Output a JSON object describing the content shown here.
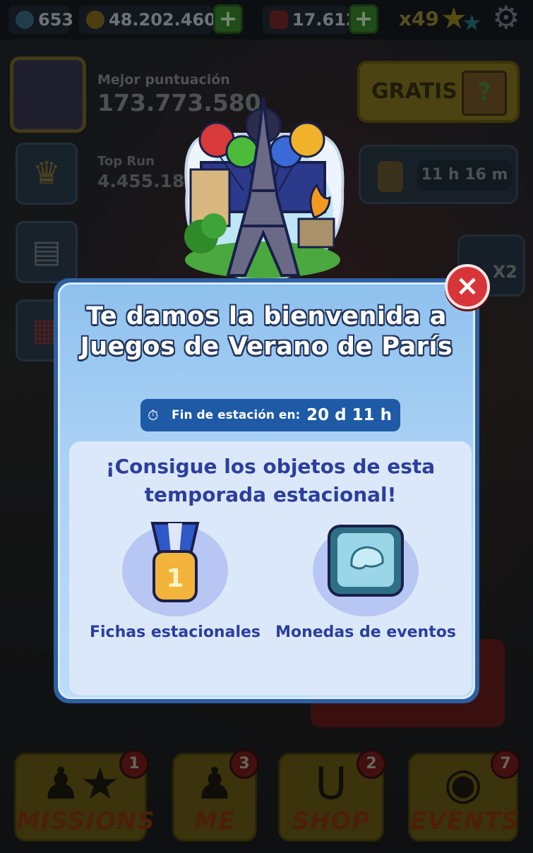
{
  "top_bar": {
    "keys": "653",
    "coins": "48.202.460",
    "boards": "17.612",
    "multiplier": "x49"
  },
  "profile": {
    "best_score_label": "Mejor puntuación",
    "best_score_value": "173.773.580",
    "top_run_label": "Top Run",
    "top_run_value": "4.455.18"
  },
  "right_panel": {
    "gratis_label": "GRATIS",
    "timer": "11 h 16 m",
    "x2_label": "X2"
  },
  "modal": {
    "title": "Te damos la bienvenida a Juegos de Verano de París",
    "season_end_label": "Fin de estación en:",
    "season_end_value": "20 d 11 h",
    "subtitle": "¡Consigue los objetos de esta temporada estacional!",
    "items": [
      {
        "label": "Fichas estacionales"
      },
      {
        "label": "Monedas de eventos"
      }
    ],
    "close": "×"
  },
  "bottom_nav": [
    {
      "label": "MISSIONS",
      "badge": "1"
    },
    {
      "label": "ME",
      "badge": "3"
    },
    {
      "label": "SHOP",
      "badge": "2"
    },
    {
      "label": "EVENTS",
      "badge": "7"
    }
  ],
  "colors": {
    "modal_blue": "#2e5fa0",
    "title_outline": "#24375f",
    "subtitle_text": "#2c3e9e",
    "close_red": "#d8353a",
    "plus_green": "#3a8a2e"
  }
}
